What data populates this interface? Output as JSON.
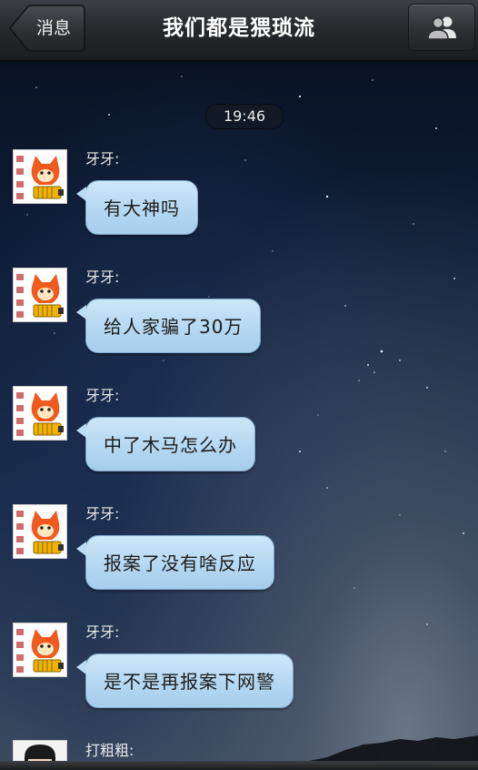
{
  "header": {
    "back_label": "消息",
    "title": "我们都是猥琐流",
    "contacts_icon": "contacts-icon"
  },
  "chat": {
    "timestamp": "19:46",
    "messages": [
      {
        "sender": "牙牙:",
        "text": "有大神吗"
      },
      {
        "sender": "牙牙:",
        "text": "给人家骗了30万"
      },
      {
        "sender": "牙牙:",
        "text": "中了木马怎么办"
      },
      {
        "sender": "牙牙:",
        "text": "报案了没有啥反应"
      },
      {
        "sender": "牙牙:",
        "text": "是不是再报案下网警"
      }
    ],
    "last_sender": "打粗粗:"
  },
  "colors": {
    "bubble": "#b5d8f2",
    "header": "#26282c"
  }
}
